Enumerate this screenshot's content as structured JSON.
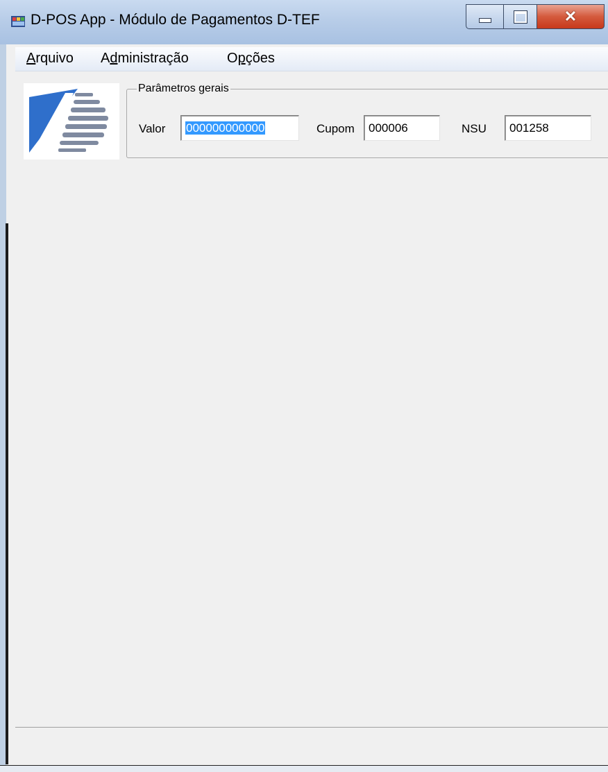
{
  "window": {
    "title": "D-POS App - Módulo de Pagamentos D-TEF"
  },
  "menu": {
    "items": [
      {
        "label": "Arquivo",
        "access_key": "A"
      },
      {
        "label": "Administração",
        "access_key": "d"
      },
      {
        "label": "Opções",
        "access_key": "p"
      }
    ]
  },
  "params": {
    "group_title": "Parâmetros gerais",
    "valor": {
      "label": "Valor",
      "value": "000000000000"
    },
    "cupom": {
      "label": "Cupom",
      "value": "000006"
    },
    "nsu": {
      "label": "NSU",
      "value": "001258"
    }
  },
  "statusbar": {
    "text": ""
  },
  "colors": {
    "selection": "#3399ff",
    "close_button": "#c7381b",
    "logo_blue": "#2f6fcb"
  }
}
